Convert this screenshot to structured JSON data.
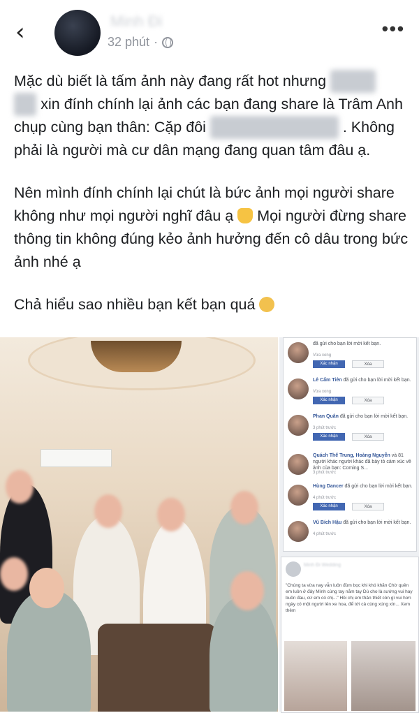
{
  "header": {
    "back_icon": "chevron-left-icon",
    "author": "Minh Đi",
    "time": "32 phút",
    "separator": "·",
    "privacy_icon": "globe-icon",
    "more_icon": "more-dots-icon"
  },
  "post": {
    "p1_a": "Mặc dù biết là tấm ảnh này đang rất hot nhưng",
    "p1_b": "xin đính chính lại ảnh các bạn đang share là Trâm Anh chụp cùng bạn thân: Cặp đôi",
    "p1_c": ". Không phải là người mà cư dân mạng đang quan tâm đâu ạ.",
    "p2_a": "Nên mình đính chính lại chút là bức ảnh mọi người share không như mọi người nghĩ đâu ạ",
    "p2_b": "Mọi người đừng share thông tin không đúng kẻo ảnh hưởng đến cô dâu trong bức ảnh nhé ạ",
    "p3": "Chả hiểu sao nhiều bạn kết bạn quá",
    "emoji_ok": "ok-hand-emoji",
    "emoji_sad": "sad-face-emoji"
  },
  "requests": {
    "confirm": "Xác nhận",
    "delete": "Xóa",
    "items": [
      {
        "name": "",
        "text": "đã gửi cho bạn lời mời kết bạn.",
        "time": "Vừa xong"
      },
      {
        "name": "Lê Cẩm Tiên",
        "text": "đã gửi cho bạn lời mời kết bạn.",
        "time": "Vừa xong"
      },
      {
        "name": "Phan Quân",
        "text": "đã gửi cho bạn lời mời kết bạn.",
        "time": "3 phút trước"
      },
      {
        "name": "Quách Thế Trung, Hoàng Nguyễn",
        "text": "và 81 người khác người khác đã bày tỏ cảm xúc về ảnh của bạn: Coming S...",
        "time": "3 phút trước"
      },
      {
        "name": "Hùng Dancer",
        "text": "đã gửi cho bạn lời mời kết bạn.",
        "time": "4 phút trước"
      },
      {
        "name": "Vũ Bích Hậu",
        "text": "đã gửi cho bạn lời mời kết bạn.",
        "time": "4 phút trước"
      }
    ]
  },
  "shared_post": {
    "author": "Minh Đi Wedding",
    "text": "\"Chúng ta vừa nay vẫn luôn đùm bọc khi khó khăn Chờ quên em luôn ở đây Mình cùng tay nắm tay Dù cho là sướng vui hay buồn đau, cứ em có chị...\" Hồi chị em thân thiết còn gì vui hơn ngày có một người lên xe hoa, để tới cả cùng xúng xín... Xem thêm"
  }
}
